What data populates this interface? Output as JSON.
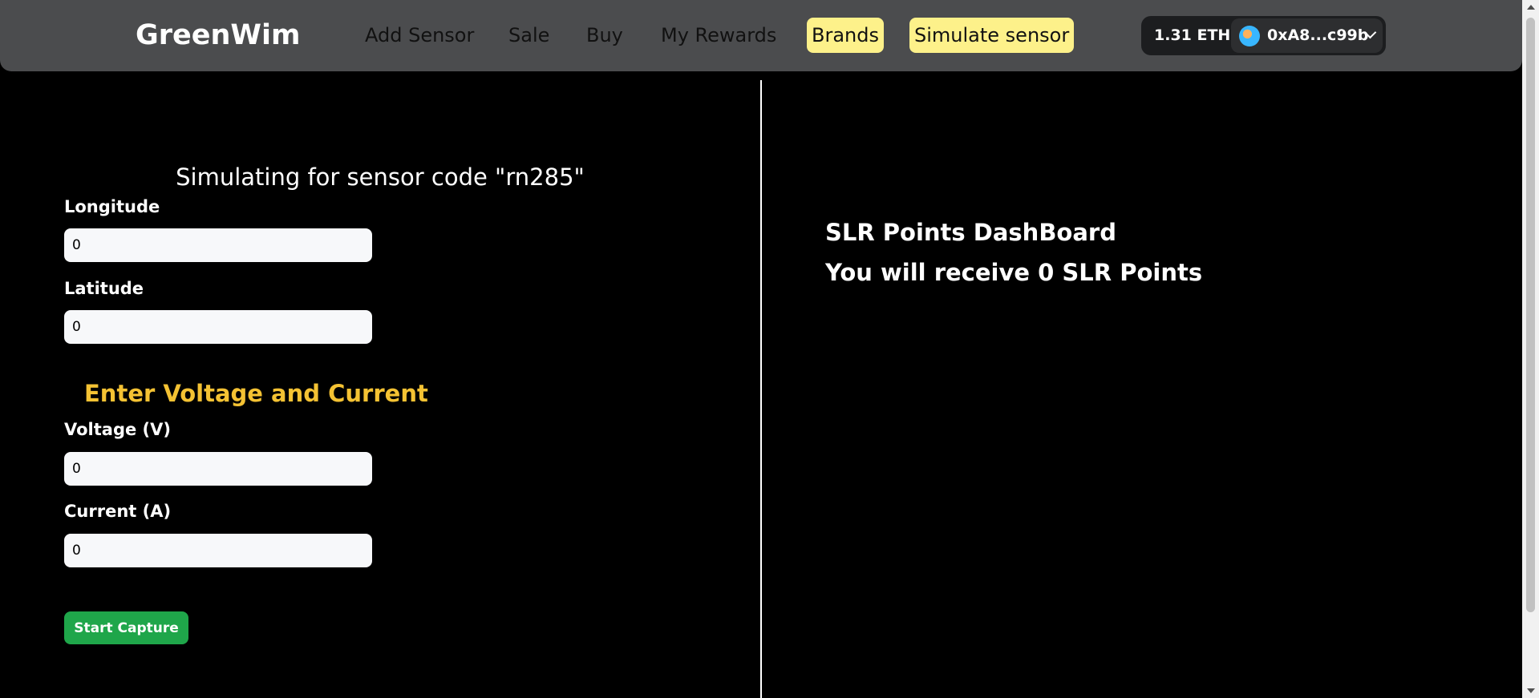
{
  "navbar": {
    "brand": "GreenWim",
    "links": [
      "Add Sensor",
      "Sale",
      "Buy",
      "My Rewards"
    ],
    "brands_button": "Brands",
    "simulate_button": "Simulate sensor",
    "wallet": {
      "balance": "1.31 ETH",
      "address": "0xA8...c99b",
      "avatar_icon": "wallet-avatar-icon",
      "dropdown_icon": "chevron-down-icon"
    }
  },
  "simulator": {
    "title": "Simulating for sensor code \"rn285\"",
    "longitude": {
      "label": "Longitude",
      "value": "0"
    },
    "latitude": {
      "label": "Latitude",
      "value": "0"
    },
    "section_title": "Enter Voltage and Current",
    "voltage": {
      "label": "Voltage (V)",
      "value": "0"
    },
    "current": {
      "label": "Current (A)",
      "value": "0"
    },
    "start_button": "Start Capture"
  },
  "dashboard": {
    "title": "SLR Points DashBoard",
    "points_text": "You will receive 0 SLR Points"
  },
  "colors": {
    "navbar_bg": "#4b4c4e",
    "pill_bg": "#fdf18a",
    "accent_yellow": "#f4c233",
    "button_green": "#1fa64a"
  }
}
